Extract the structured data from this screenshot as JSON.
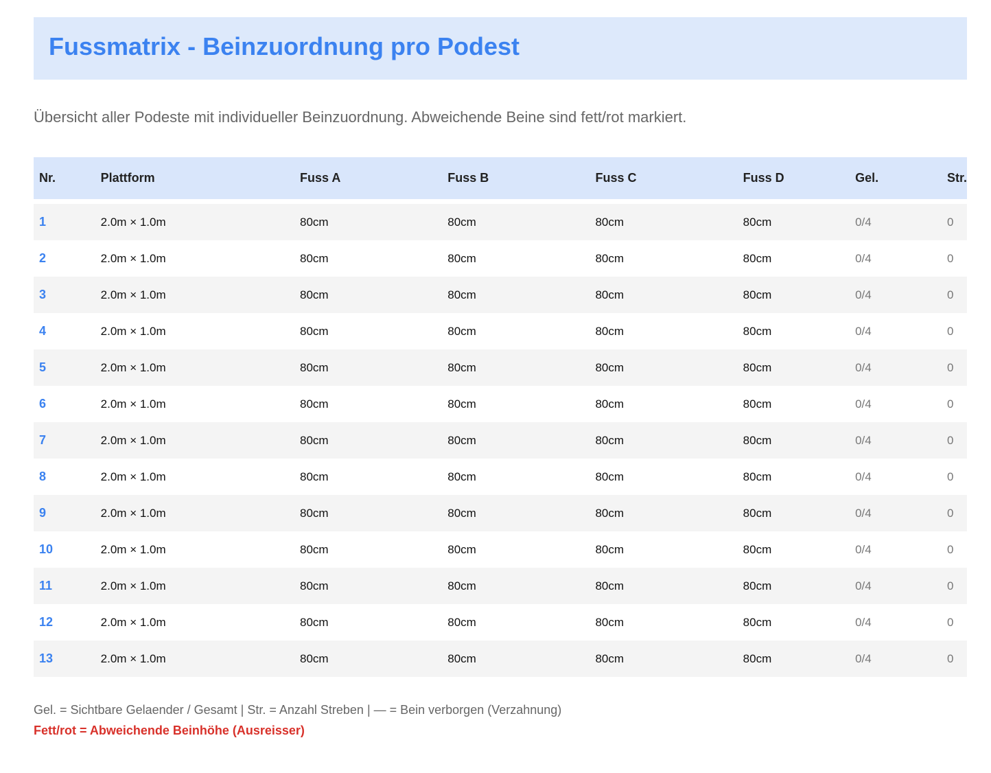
{
  "title": "Fussmatrix - Beinzuordnung pro Podest",
  "subtitle": "Übersicht aller Podeste mit individueller Beinzuordnung. Abweichende Beine sind fett/rot markiert.",
  "colors": {
    "accent": "#3b82f0",
    "header_bg": "#dde9fb",
    "highlight_red": "#d8312a"
  },
  "table": {
    "headers": [
      "Nr.",
      "Plattform",
      "Fuss A",
      "Fuss B",
      "Fuss C",
      "Fuss D",
      "Gel.",
      "Str."
    ],
    "rows": [
      {
        "nr": "1",
        "plattform": "2.0m × 1.0m",
        "fuss_a": "80cm",
        "fuss_b": "80cm",
        "fuss_c": "80cm",
        "fuss_d": "80cm",
        "gel": "0/4",
        "str": "0"
      },
      {
        "nr": "2",
        "plattform": "2.0m × 1.0m",
        "fuss_a": "80cm",
        "fuss_b": "80cm",
        "fuss_c": "80cm",
        "fuss_d": "80cm",
        "gel": "0/4",
        "str": "0"
      },
      {
        "nr": "3",
        "plattform": "2.0m × 1.0m",
        "fuss_a": "80cm",
        "fuss_b": "80cm",
        "fuss_c": "80cm",
        "fuss_d": "80cm",
        "gel": "0/4",
        "str": "0"
      },
      {
        "nr": "4",
        "plattform": "2.0m × 1.0m",
        "fuss_a": "80cm",
        "fuss_b": "80cm",
        "fuss_c": "80cm",
        "fuss_d": "80cm",
        "gel": "0/4",
        "str": "0"
      },
      {
        "nr": "5",
        "plattform": "2.0m × 1.0m",
        "fuss_a": "80cm",
        "fuss_b": "80cm",
        "fuss_c": "80cm",
        "fuss_d": "80cm",
        "gel": "0/4",
        "str": "0"
      },
      {
        "nr": "6",
        "plattform": "2.0m × 1.0m",
        "fuss_a": "80cm",
        "fuss_b": "80cm",
        "fuss_c": "80cm",
        "fuss_d": "80cm",
        "gel": "0/4",
        "str": "0"
      },
      {
        "nr": "7",
        "plattform": "2.0m × 1.0m",
        "fuss_a": "80cm",
        "fuss_b": "80cm",
        "fuss_c": "80cm",
        "fuss_d": "80cm",
        "gel": "0/4",
        "str": "0"
      },
      {
        "nr": "8",
        "plattform": "2.0m × 1.0m",
        "fuss_a": "80cm",
        "fuss_b": "80cm",
        "fuss_c": "80cm",
        "fuss_d": "80cm",
        "gel": "0/4",
        "str": "0"
      },
      {
        "nr": "9",
        "plattform": "2.0m × 1.0m",
        "fuss_a": "80cm",
        "fuss_b": "80cm",
        "fuss_c": "80cm",
        "fuss_d": "80cm",
        "gel": "0/4",
        "str": "0"
      },
      {
        "nr": "10",
        "plattform": "2.0m × 1.0m",
        "fuss_a": "80cm",
        "fuss_b": "80cm",
        "fuss_c": "80cm",
        "fuss_d": "80cm",
        "gel": "0/4",
        "str": "0"
      },
      {
        "nr": "11",
        "plattform": "2.0m × 1.0m",
        "fuss_a": "80cm",
        "fuss_b": "80cm",
        "fuss_c": "80cm",
        "fuss_d": "80cm",
        "gel": "0/4",
        "str": "0"
      },
      {
        "nr": "12",
        "plattform": "2.0m × 1.0m",
        "fuss_a": "80cm",
        "fuss_b": "80cm",
        "fuss_c": "80cm",
        "fuss_d": "80cm",
        "gel": "0/4",
        "str": "0"
      },
      {
        "nr": "13",
        "plattform": "2.0m × 1.0m",
        "fuss_a": "80cm",
        "fuss_b": "80cm",
        "fuss_c": "80cm",
        "fuss_d": "80cm",
        "gel": "0/4",
        "str": "0"
      }
    ]
  },
  "legend": {
    "line1": "Gel. = Sichtbare Gelaender / Gesamt | Str. = Anzahl Streben | — = Bein verborgen (Verzahnung)",
    "line2": "Fett/rot = Abweichende Beinhöhe (Ausreisser)"
  }
}
